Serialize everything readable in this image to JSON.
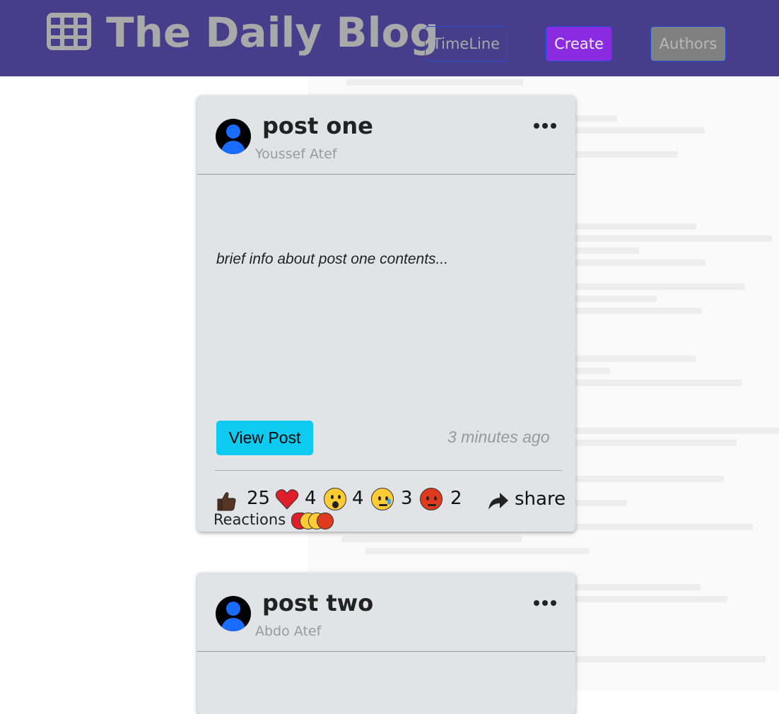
{
  "navbar": {
    "brand_icon": "grid-table-icon",
    "title": "The Daily Blog",
    "buttons": {
      "timeline": "TimeLine",
      "create": "Create",
      "authors": "Authors"
    }
  },
  "colors": {
    "navbar_bg": "#483d8b",
    "create_bg": "#8a2be2",
    "authors_bg": "#808080",
    "view_post_bg": "#0dcaf0",
    "card_bg": "#e2e3e7"
  },
  "posts": [
    {
      "title": "post one",
      "author": "Youssef Atef",
      "brief": "brief info about post one contents...",
      "view_label": "View Post",
      "time": "3 minutes ago",
      "reactions": {
        "like": "25",
        "love": "4",
        "wow": "4",
        "sad": "3",
        "angry": "2"
      },
      "share_label": "share",
      "reactions_label": "Reactions"
    },
    {
      "title": "post two",
      "author": "Abdo Atef"
    }
  ]
}
